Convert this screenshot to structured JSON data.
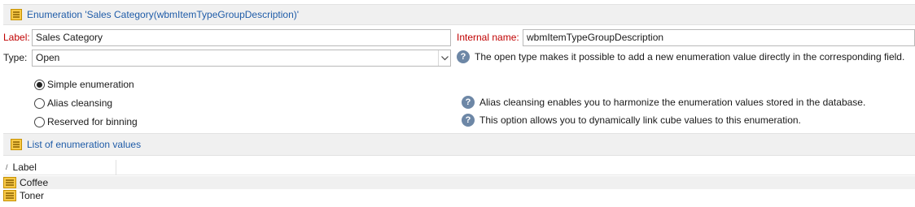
{
  "header": {
    "title": "Enumeration 'Sales Category(wbmItemTypeGroupDescription)'"
  },
  "form": {
    "label_caption": "Label:",
    "label_value": "Sales Category",
    "internal_caption": "Internal name:",
    "internal_value": "wbmItemTypeGroupDescription",
    "type_caption": "Type:",
    "type_value": "Open",
    "type_help": "The open type makes it possible to add a new enumeration value directly in the corresponding field."
  },
  "options": [
    {
      "label": "Simple enumeration",
      "selected": true,
      "help": ""
    },
    {
      "label": "Alias cleansing",
      "selected": false,
      "help": "Alias cleansing enables you to harmonize the enumeration values stored in the database."
    },
    {
      "label": "Reserved for binning",
      "selected": false,
      "help": "This option allows you to dynamically link cube values to this enumeration."
    }
  ],
  "list": {
    "title": "List of enumeration values",
    "columns": [
      "Label"
    ],
    "rows": [
      {
        "label": "Coffee"
      },
      {
        "label": "Toner"
      }
    ]
  },
  "colors": {
    "accent": "#1f5ca8",
    "required": "#c00000",
    "icon": "#f2b400",
    "help": "#6d87a6"
  },
  "icons": {
    "enumeration": "enumeration-icon",
    "help": "help-icon",
    "select": "chevron-down-icon"
  }
}
